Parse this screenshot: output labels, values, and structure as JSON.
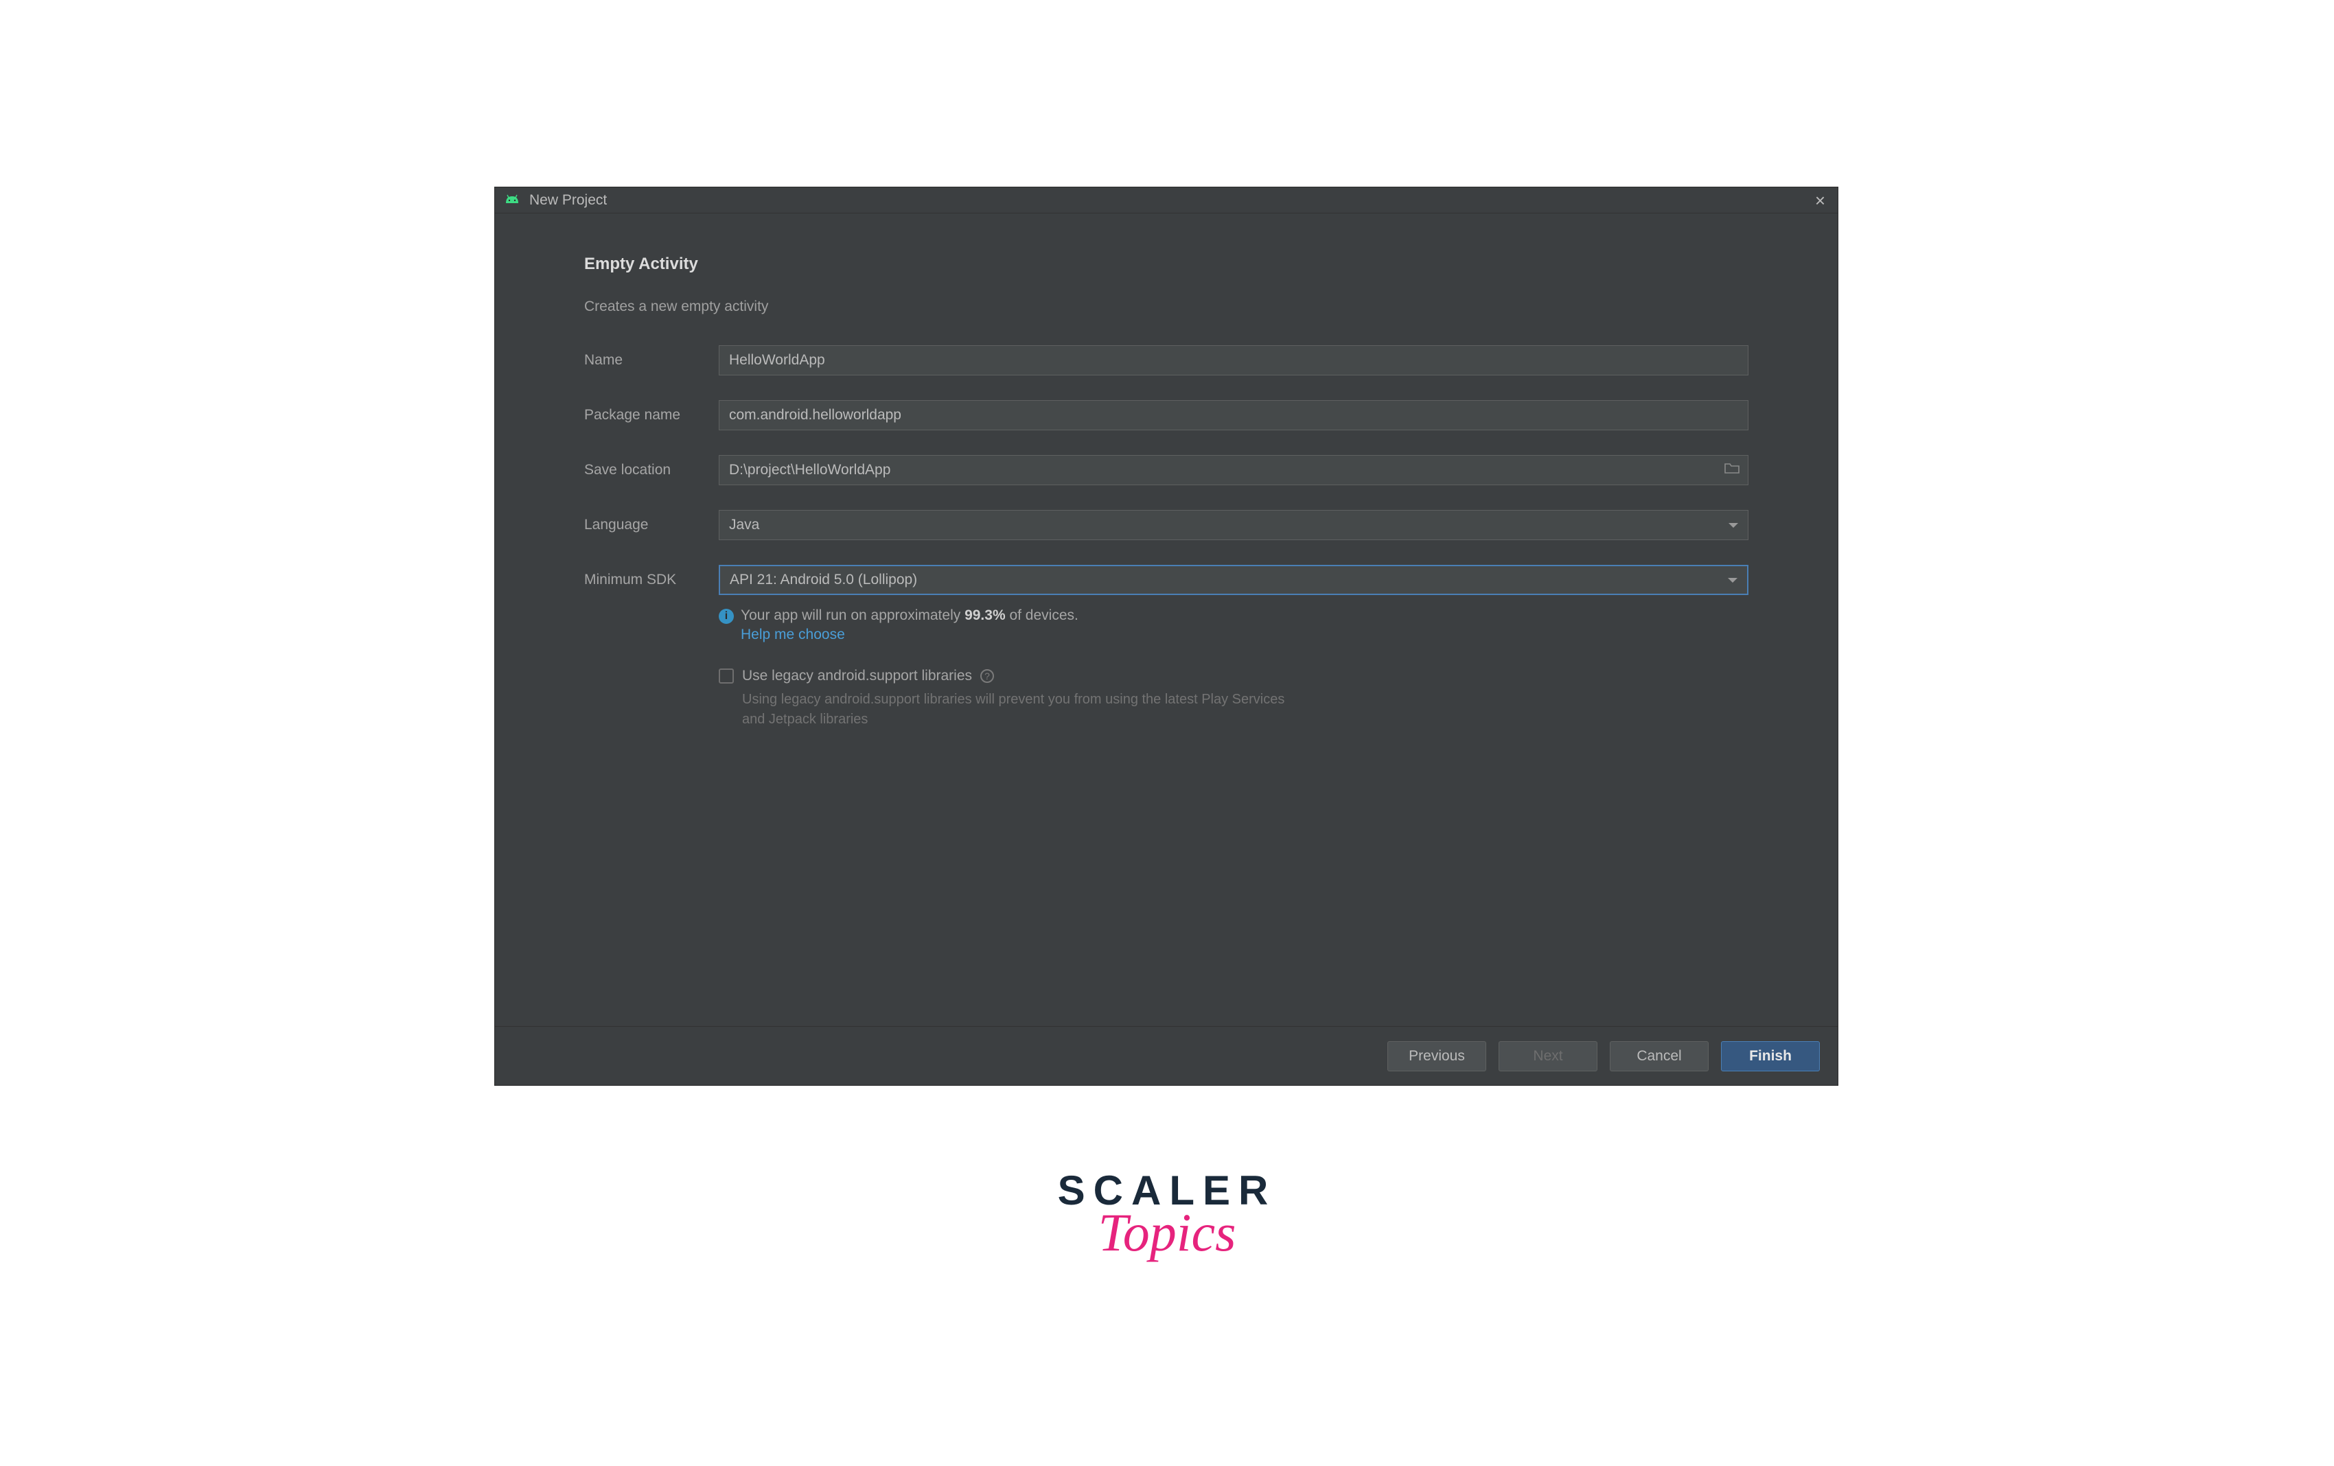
{
  "titlebar": {
    "title": "New Project"
  },
  "header": {
    "heading": "Empty Activity",
    "subtext": "Creates a new empty activity"
  },
  "form": {
    "name_label": "Name",
    "name_value": "HelloWorldApp",
    "package_label": "Package name",
    "package_value": "com.android.helloworldapp",
    "save_label": "Save location",
    "save_value": "D:\\project\\HelloWorldApp",
    "language_label": "Language",
    "language_value": "Java",
    "minsdk_label": "Minimum SDK",
    "minsdk_value": "API 21: Android 5.0 (Lollipop)"
  },
  "info": {
    "prefix": "Your app will run on approximately ",
    "pct": "99.3%",
    "suffix": " of devices.",
    "help": "Help me choose"
  },
  "legacy": {
    "label": "Use legacy android.support libraries",
    "sub": "Using legacy android.support libraries will prevent you from using the latest Play Services and Jetpack libraries"
  },
  "buttons": {
    "previous": "Previous",
    "next": "Next",
    "cancel": "Cancel",
    "finish": "Finish"
  },
  "watermark": {
    "line1": "SCALER",
    "line2": "Topics"
  }
}
